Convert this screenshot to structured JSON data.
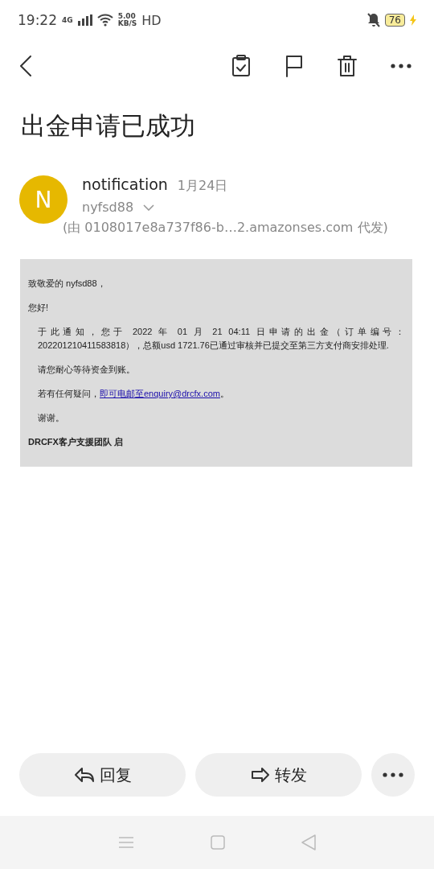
{
  "status_bar": {
    "time": "19:22",
    "network": "4G",
    "speed": "5.00",
    "speed_unit": "KB/S",
    "hd": "HD",
    "battery": "76"
  },
  "subject": "出金申请已成功",
  "sender": {
    "initial": "N",
    "name": "notification",
    "date": "1月24日",
    "recipient": "nyfsd88",
    "via": "(由 0108017e8a737f86-b…2.amazonses.com 代发)"
  },
  "body": {
    "greeting": "致敬爱的 nyfsd88，",
    "hello": "您好!",
    "paragraphs": [
      {
        "kind": "text",
        "text": "于此通知，您于 2022 年 01 月 21 04:11 日申请的出金（订单编号：202201210411583818），总额usd 1721.76已通过审核并已提交至第三方支付商安排处理."
      },
      {
        "kind": "text",
        "text": "请您耐心等待资金到账。"
      },
      {
        "kind": "link",
        "before": "若有任何疑问，",
        "link": "即可电邮至enquiry@drcfx.com",
        "after": "。"
      },
      {
        "kind": "text",
        "text": "谢谢。"
      }
    ],
    "signature": "DRCFX客户支援团队 启"
  },
  "actions": [
    {
      "kind": "reply",
      "label": "回复"
    },
    {
      "kind": "forward",
      "label": "转发"
    }
  ]
}
